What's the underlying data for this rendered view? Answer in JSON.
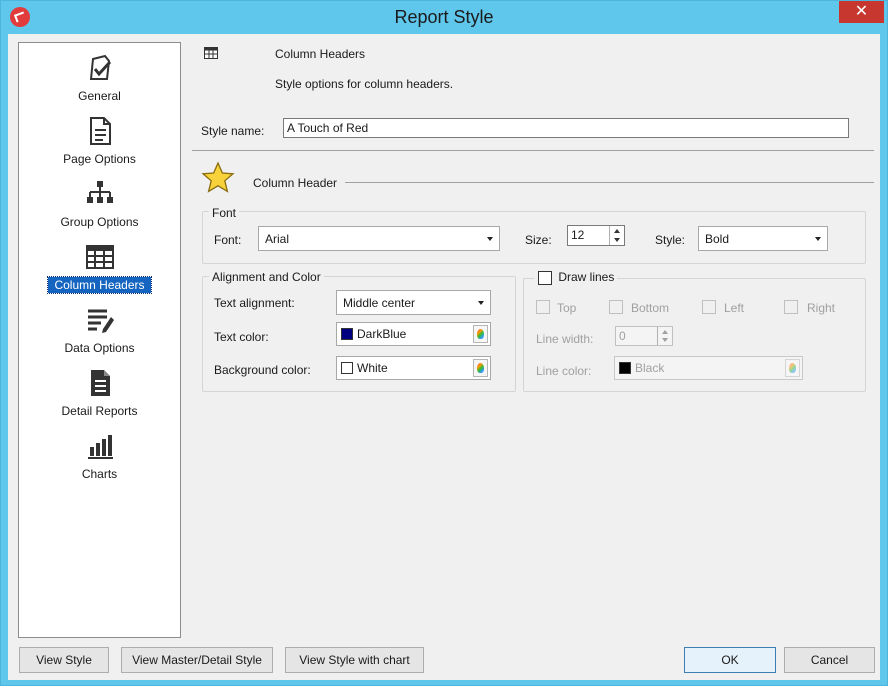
{
  "window": {
    "title": "Report Style",
    "close_glyph": "✕"
  },
  "sidebar": {
    "items": [
      {
        "label": "General",
        "icon": "general-check-icon"
      },
      {
        "label": "Page Options",
        "icon": "page-icon"
      },
      {
        "label": "Group Options",
        "icon": "hierarchy-icon"
      },
      {
        "label": "Column Headers",
        "icon": "table-icon",
        "selected": true
      },
      {
        "label": "Data Options",
        "icon": "data-lines-icon"
      },
      {
        "label": "Detail Reports",
        "icon": "report-doc-icon"
      },
      {
        "label": "Charts",
        "icon": "bar-chart-icon"
      }
    ]
  },
  "header": {
    "title": "Column Headers",
    "description": "Style options for column headers."
  },
  "style_name": {
    "label": "Style name:",
    "value": "A Touch of Red"
  },
  "section": {
    "title": "Column Header",
    "icon": "star-icon"
  },
  "font_group": {
    "title": "Font",
    "font_label": "Font:",
    "font_value": "Arial",
    "size_label": "Size:",
    "size_value": "12",
    "style_label": "Style:",
    "style_value": "Bold"
  },
  "align_group": {
    "title": "Alignment and Color",
    "text_alignment_label": "Text alignment:",
    "text_alignment_value": "Middle center",
    "text_color_label": "Text color:",
    "text_color_value": "DarkBlue",
    "text_color_hex": "#000080",
    "bg_color_label": "Background color:",
    "bg_color_value": "White",
    "bg_color_hex": "#ffffff"
  },
  "lines_group": {
    "title": "Draw lines",
    "checked": false,
    "top": "Top",
    "bottom": "Bottom",
    "left": "Left",
    "right": "Right",
    "line_width_label": "Line width:",
    "line_width_value": "0",
    "line_color_label": "Line color:",
    "line_color_value": "Black",
    "line_color_hex": "#000000"
  },
  "buttons": {
    "view_style": "View Style",
    "view_master_detail": "View Master/Detail Style",
    "view_style_chart": "View Style with chart",
    "ok": "OK",
    "cancel": "Cancel"
  }
}
